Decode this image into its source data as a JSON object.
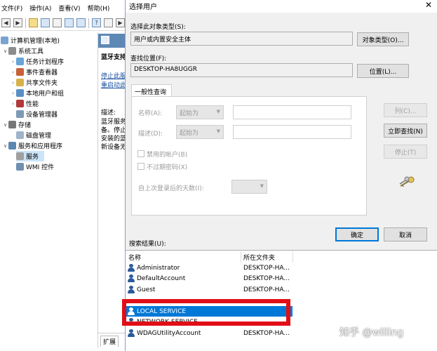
{
  "menu": [
    "文件(F)",
    "操作(A)",
    "查看(V)",
    "帮助(H)"
  ],
  "tree": {
    "root": "计算机管理(本地)",
    "system_tools": "系统工具",
    "task_scheduler": "任务计划程序",
    "event_viewer": "事件查看器",
    "shared_folders": "共享文件夹",
    "local_users": "本地用户和组",
    "performance": "性能",
    "device_manager": "设备管理器",
    "storage": "存储",
    "disk_management": "磁盘管理",
    "services_apps": "服务和应用程序",
    "services": "服务",
    "wmi": "WMI 控件"
  },
  "middle": {
    "header": "蓝牙支持",
    "stop_link": "停止此服",
    "restart_link": "重启动此",
    "desc_label": "描述:",
    "desc_lines": [
      "蓝牙服务",
      "备。停止",
      "安装的蓝",
      "新设备无"
    ],
    "tab_expand": "扩展"
  },
  "dialog": {
    "title": "选择用户",
    "close": "✕",
    "object_type_label": "选择此对象类型(S):",
    "object_type_value": "用户或内置安全主体",
    "object_type_button": "对象类型(O)...",
    "location_label": "查找位置(F):",
    "location_value": "DESKTOP-HA8UGGR",
    "location_button": "位置(L)...",
    "tab_general": "一般性查询",
    "name_label": "名称(A):",
    "name_mode": "起始为",
    "desc_label": "描述(D):",
    "desc_mode": "起始为",
    "disabled_accounts": "禁用的帐户(B)",
    "no_expire_pwd": "不过期密码(X)",
    "days_since_login": "自上次登录后的天数(I):",
    "columns_button": "列(C)...",
    "find_now_button": "立即查找(N)",
    "stop_button": "停止(T)",
    "ok_button": "确定",
    "cancel_button": "取消",
    "results_label": "搜索结果(U):",
    "col_name": "名称",
    "col_folder": "所在文件夹",
    "results": [
      {
        "name": "Administrator",
        "folder": "DESKTOP-HA..."
      },
      {
        "name": "DefaultAccount",
        "folder": "DESKTOP-HA..."
      },
      {
        "name": "Guest",
        "folder": "DESKTOP-HA..."
      },
      {
        "name": "LOCAL SERVICE",
        "folder": ""
      },
      {
        "name": "NETWORK SERVICE",
        "folder": ""
      },
      {
        "name": "WDAGUtilityAccount",
        "folder": "DESKTOP-HA..."
      }
    ]
  },
  "watermark": "知乎 @willing"
}
